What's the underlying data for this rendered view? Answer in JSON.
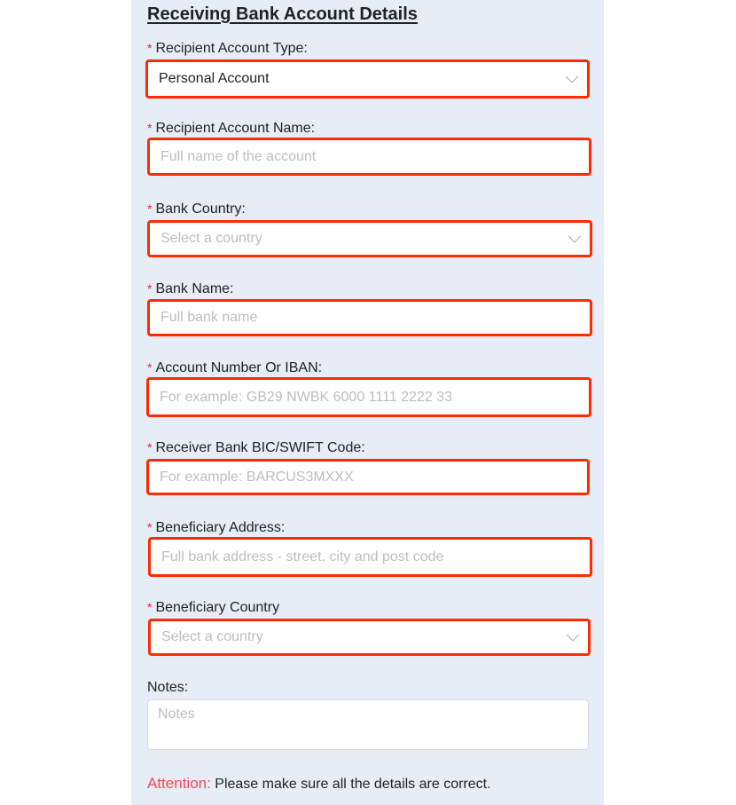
{
  "section_title": "Receiving Bank Account Details",
  "required_mark": "*",
  "fields": [
    {
      "label": "Recipient Account Type:",
      "type": "select",
      "value": "Personal Account",
      "placeholder": ""
    },
    {
      "label": "Recipient Account Name:",
      "type": "input",
      "value": "",
      "placeholder": "Full name of the account"
    },
    {
      "label": "Bank Country:",
      "type": "select",
      "value": "",
      "placeholder": "Select a country"
    },
    {
      "label": "Bank Name:",
      "type": "input",
      "value": "",
      "placeholder": "Full bank name"
    },
    {
      "label": "Account Number Or IBAN:",
      "type": "input",
      "value": "",
      "placeholder": "For example: GB29 NWBK 6000 1111 2222 33"
    },
    {
      "label": "Receiver Bank BIC/SWIFT Code:",
      "type": "input",
      "value": "",
      "placeholder": "For example: BARCUS3MXXX"
    },
    {
      "label": "Beneficiary Address:",
      "type": "input",
      "value": "",
      "placeholder": "Full bank address - street, city and post code"
    },
    {
      "label": "Beneficiary Country",
      "type": "select",
      "value": "",
      "placeholder": "Select a country"
    }
  ],
  "notes": {
    "label": "Notes:",
    "placeholder": "Notes"
  },
  "attention": {
    "prefix": "Attention:",
    "message": "Please make sure all the details are correct."
  },
  "colors": {
    "panel_bg": "#e7edf6",
    "highlight": "#ff2a00",
    "required": "#f5222d",
    "attention": "#f5474f"
  }
}
